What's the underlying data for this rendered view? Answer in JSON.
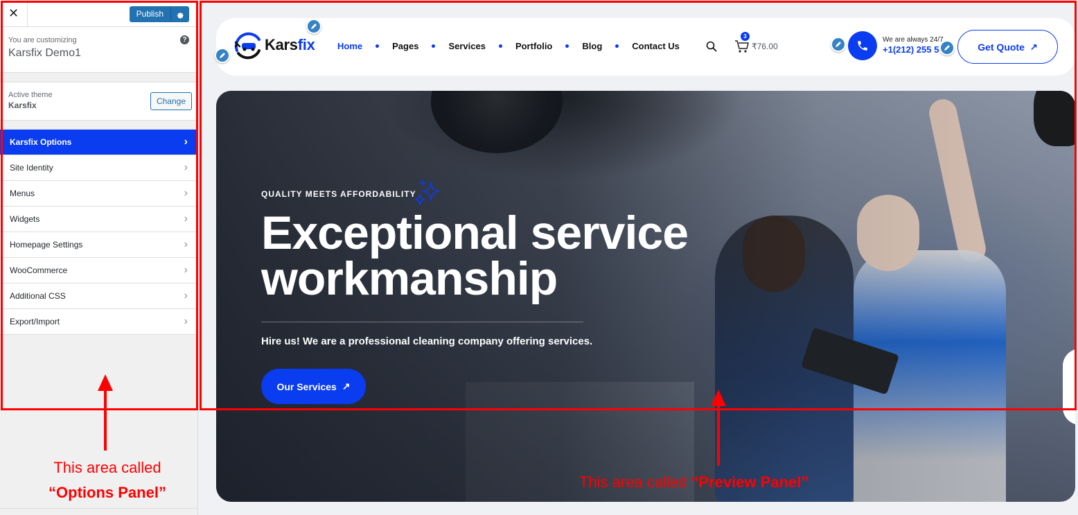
{
  "options_panel": {
    "close_label": "✕",
    "publish_label": "Publish",
    "customizing_label": "You are customizing",
    "site_name": "Karsfix Demo1",
    "help_label": "?",
    "active_theme_label": "Active theme",
    "active_theme_name": "Karsfix",
    "change_label": "Change",
    "items": [
      {
        "label": "Karsfix Options",
        "active": true
      },
      {
        "label": "Site Identity"
      },
      {
        "label": "Menus"
      },
      {
        "label": "Widgets"
      },
      {
        "label": "Homepage Settings"
      },
      {
        "label": "WooCommerce"
      },
      {
        "label": "Additional CSS"
      },
      {
        "label": "Export/Import"
      }
    ]
  },
  "preview": {
    "logo_main": "Kars",
    "logo_accent": "fix",
    "nav": [
      "Home",
      "Pages",
      "Services",
      "Portfolio",
      "Blog",
      "Contact Us"
    ],
    "cart_count": "3",
    "cart_price": "₹76.00",
    "phone_caption": "We are always 24/7",
    "phone_number": "+1(212) 255 5",
    "quote_label": "Get Quote",
    "hero": {
      "tagline": "QUALITY MEETS AFFORDABILITY",
      "title_line1": "Exceptional service",
      "title_line2": "workmanship",
      "subtitle": "Hire us! We are a professional cleaning company offering services.",
      "button_label": "Our Services"
    }
  },
  "annotations": {
    "options_note_line1": "This area called",
    "options_note_line2": "“Options Panel”",
    "preview_note_prefix": "This area called ",
    "preview_note_bold": "“Preview Panel”"
  },
  "colors": {
    "brand_blue": "#0a3cf0",
    "wp_blue": "#2271b1",
    "annotation_red": "#ff0000"
  }
}
